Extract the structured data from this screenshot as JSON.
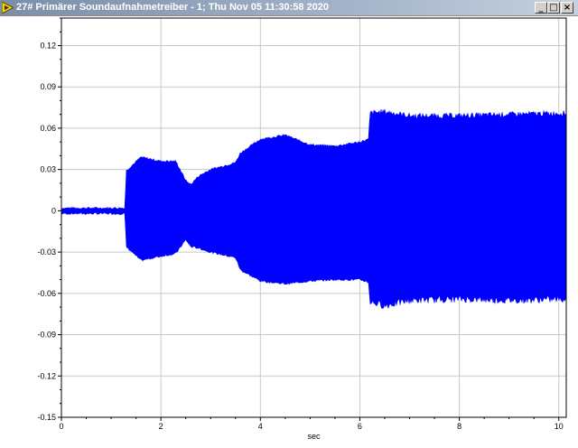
{
  "window": {
    "title": "27# Primärer Soundaufnahmetreiber - 1; Thu Nov 05 11:30:58 2020",
    "minimize_label": "_",
    "maximize_label": "□",
    "close_label": "×"
  },
  "chart_data": {
    "type": "area",
    "xlabel": "sec",
    "ylabel": "",
    "xlim": [
      0,
      10.15
    ],
    "ylim": [
      -0.15,
      0.14
    ],
    "grid": true,
    "color": "#0000ff",
    "x_ticks": [
      0,
      2,
      4,
      6,
      8,
      10
    ],
    "y_ticks": [
      0.12,
      0.09,
      0.06,
      0.03,
      0,
      -0.03,
      -0.06,
      -0.09,
      -0.12,
      -0.15
    ],
    "y_tick_labels": [
      "0.12",
      "0.09",
      "0.06",
      "0.03",
      "0",
      "-0.03",
      "-0.06",
      "-0.09",
      "-0.12",
      "-0.15"
    ],
    "envelope": {
      "x": [
        0,
        1.28,
        1.3,
        1.6,
        2.0,
        2.3,
        2.5,
        2.6,
        2.75,
        3.0,
        3.5,
        3.6,
        4.0,
        4.5,
        5.0,
        5.5,
        6.0,
        6.18,
        6.2,
        6.5,
        7.0,
        8.0,
        9.0,
        10.2
      ],
      "upper": [
        0.002,
        0.002,
        0.029,
        0.039,
        0.036,
        0.036,
        0.022,
        0.019,
        0.025,
        0.03,
        0.035,
        0.042,
        0.052,
        0.055,
        0.048,
        0.047,
        0.05,
        0.052,
        0.071,
        0.072,
        0.069,
        0.069,
        0.07,
        0.071
      ],
      "lower": [
        -0.002,
        -0.002,
        -0.026,
        -0.036,
        -0.033,
        -0.031,
        -0.021,
        -0.026,
        -0.027,
        -0.03,
        -0.034,
        -0.043,
        -0.051,
        -0.053,
        -0.051,
        -0.05,
        -0.05,
        -0.052,
        -0.066,
        -0.069,
        -0.065,
        -0.064,
        -0.065,
        -0.064
      ]
    }
  }
}
